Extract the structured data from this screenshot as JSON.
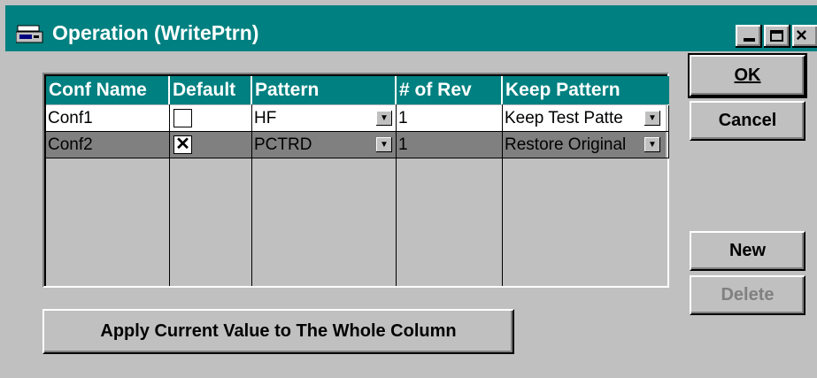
{
  "window": {
    "title": "Operation (WritePtrn)"
  },
  "grid": {
    "headers": [
      "Conf Name",
      "Default",
      "Pattern",
      "# of Rev",
      "Keep Pattern"
    ],
    "rows": [
      {
        "conf_name": "Conf1",
        "default_checked": false,
        "default_mark": "",
        "pattern": "HF",
        "rev": "1",
        "keep": "Keep Test Patte"
      },
      {
        "conf_name": "Conf2",
        "default_checked": true,
        "default_mark": "✕",
        "pattern": "PCTRD",
        "rev": "1",
        "keep": "Restore Original"
      }
    ]
  },
  "buttons": {
    "ok": "OK",
    "cancel": "Cancel",
    "new": "New",
    "delete": "Delete",
    "apply": "Apply Current Value to The Whole Column"
  },
  "icons": {
    "dropdown": "▼"
  },
  "colors": {
    "title_bar": "#008080",
    "header": "#008080",
    "selected_row": "#808080",
    "face": "#c0c0c0"
  }
}
